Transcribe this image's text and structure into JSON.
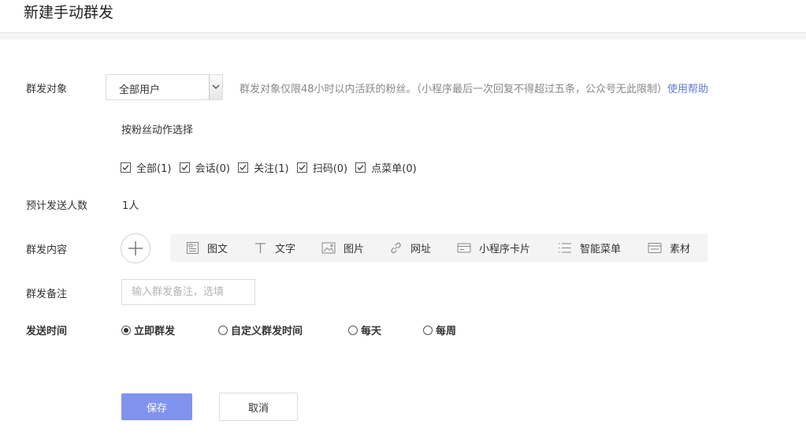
{
  "header": {
    "title": "新建手动群发"
  },
  "labels": {
    "target": "群发对象",
    "estimate": "预计发送人数",
    "content": "群发内容",
    "remark": "群发备注",
    "send_time": "发送时间"
  },
  "target_select": {
    "value": "全部用户"
  },
  "hint": {
    "text": "群发对象仅限48小时以内活跃的粉丝。（小程序最后一次回复不得超过五条，公众号无此限制）",
    "link": "使用帮助"
  },
  "filter": {
    "title": "按粉丝动作选择",
    "options": [
      {
        "label": "全部(1)",
        "checked": true
      },
      {
        "label": "会话(0)",
        "checked": true
      },
      {
        "label": "关注(1)",
        "checked": true
      },
      {
        "label": "扫码(0)",
        "checked": true
      },
      {
        "label": "点菜单(0)",
        "checked": true
      }
    ]
  },
  "estimate_value": "1人",
  "content_tools": [
    {
      "label": "图文",
      "icon": "article-icon"
    },
    {
      "label": "文字",
      "icon": "text-icon"
    },
    {
      "label": "图片",
      "icon": "image-icon"
    },
    {
      "label": "网址",
      "icon": "link-icon"
    },
    {
      "label": "小程序卡片",
      "icon": "card-icon"
    },
    {
      "label": "智能菜单",
      "icon": "menu-list-icon"
    },
    {
      "label": "素材",
      "icon": "material-icon"
    }
  ],
  "remark_input": {
    "placeholder": "输入群发备注，选填",
    "value": ""
  },
  "send_time_options": [
    {
      "label": "立即群发",
      "selected": true
    },
    {
      "label": "自定义群发时间",
      "selected": false
    },
    {
      "label": "每天",
      "selected": false
    },
    {
      "label": "每周",
      "selected": false
    }
  ],
  "buttons": {
    "save": "保存",
    "cancel": "取消"
  },
  "colors": {
    "accent": "#8093ee",
    "link": "#5b7cde",
    "toolbar_bg": "#f4f4f4"
  }
}
